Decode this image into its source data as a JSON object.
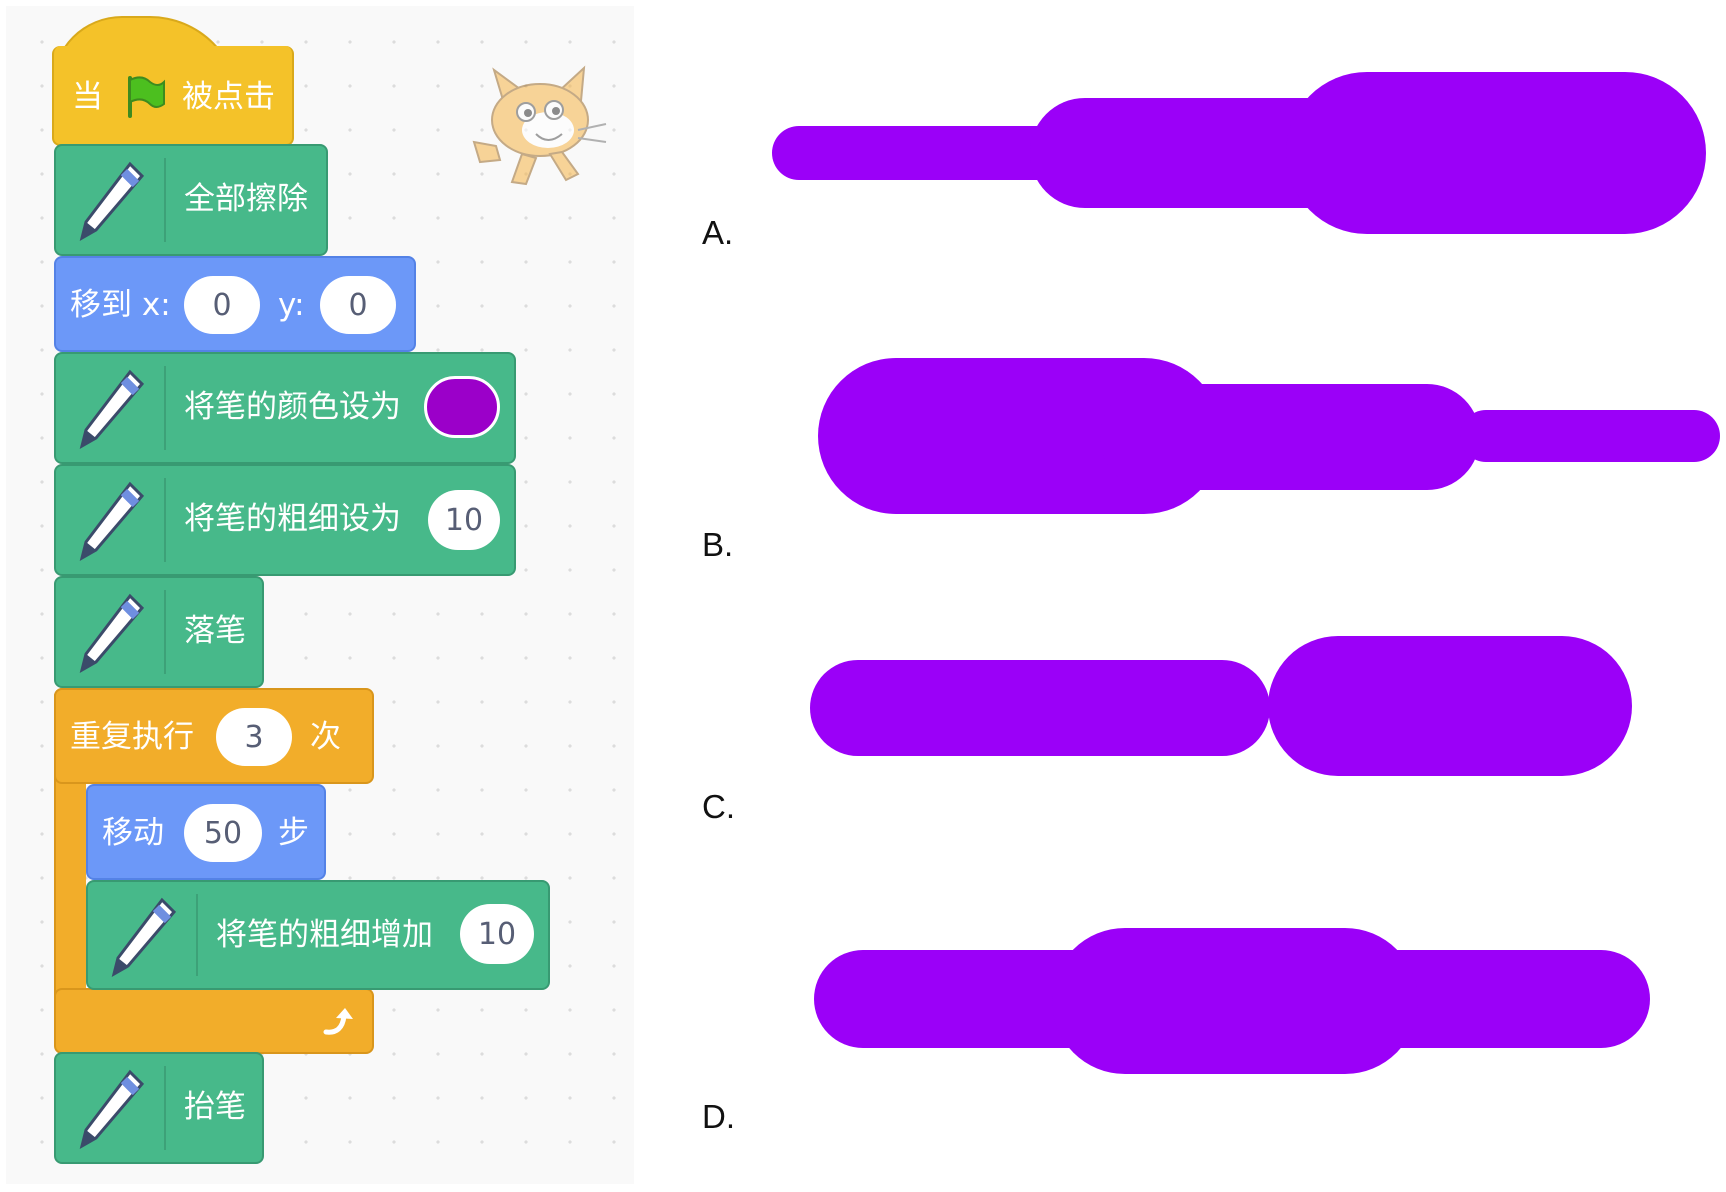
{
  "code": {
    "hat": {
      "prefix": "当",
      "suffix": "被点击",
      "flag_icon": "green-flag-icon"
    },
    "clear_all": "全部擦除",
    "goto": {
      "label": "移到 x:",
      "x_value": "0",
      "y_label": "y:",
      "y_value": "0"
    },
    "set_pen_color": {
      "label": "将笔的颜色设为",
      "color": "#9b00c9"
    },
    "set_pen_size": {
      "label": "将笔的粗细设为",
      "value": "10"
    },
    "pen_down": "落笔",
    "repeat": {
      "label": "重复执行",
      "times": "3",
      "suffix": "次",
      "loop_icon": "loop-arrow-icon"
    },
    "move": {
      "label": "移动",
      "steps": "50",
      "suffix": "步"
    },
    "change_pen_size": {
      "label": "将笔的粗细增加",
      "value": "10"
    },
    "pen_up": "抬笔",
    "sprite_icon": "scratch-cat-icon"
  },
  "options": [
    {
      "label": "A.",
      "shape": "thin-medium-thick"
    },
    {
      "label": "B.",
      "shape": "thick-medium-thin"
    },
    {
      "label": "C.",
      "shape": "medium-thick"
    },
    {
      "label": "D.",
      "shape": "medium-thick-medium"
    }
  ],
  "colors": {
    "stroke": "#9b00f8",
    "pen_block": "#47b98a",
    "motion_block": "#6c98f8",
    "event_block": "#f4c229",
    "control_block": "#f2ad2a"
  }
}
